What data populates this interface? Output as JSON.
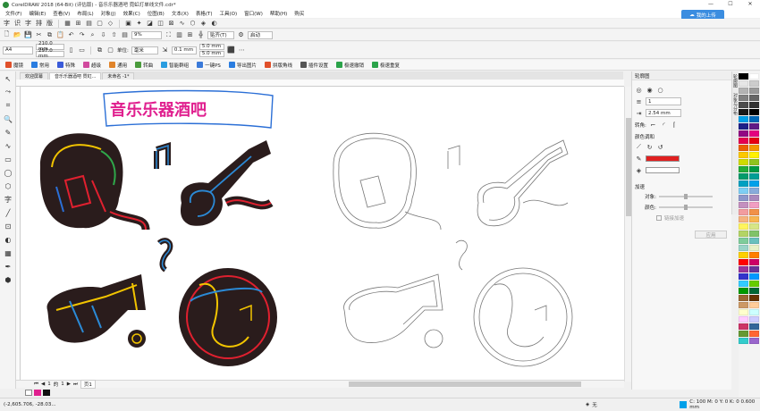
{
  "window": {
    "title": "CorelDRAW 2018 (64-Bit) (评估版) - 音乐乐器酒吧 霓虹灯单线文件.cdr*",
    "controls": [
      "—",
      "☐",
      "✕"
    ]
  },
  "menu": [
    "文件(F)",
    "编辑(E)",
    "查看(V)",
    "布局(L)",
    "对象(J)",
    "效果(C)",
    "位图(B)",
    "文本(X)",
    "表格(T)",
    "工具(O)",
    "窗口(W)",
    "帮助(H)",
    "购买"
  ],
  "cloud_button": "我的上传",
  "standard_bar": {
    "zoom": "9%",
    "snap": "贴齐(T)",
    "launch": "启动"
  },
  "property_bar": {
    "page_size": "A4",
    "width": "210.0 mm",
    "height": "297.0 mm",
    "units": "毫米",
    "nudge": "0.1 mm",
    "dup_x": "5.0 mm",
    "dup_y": "5.0 mm"
  },
  "plugin_bar": [
    "魔镜",
    "常用",
    "特殊",
    "超级",
    "通用",
    "转曲",
    "智能群组",
    "一键PS",
    "导出图片",
    "拼版角线",
    "插件设置",
    "极速撤销",
    "极速重复"
  ],
  "plugin_colors": [
    "#e0502a",
    "#2a7de0",
    "#3b5bd9",
    "#d14a9e",
    "#e0842a",
    "#4a9b3c",
    "#2a9de0",
    "#3b7ad9",
    "#2a7de0",
    "#e0502a",
    "#555555",
    "#2ba34a",
    "#2ba34a"
  ],
  "doc_tabs": [
    "欢迎屏幕",
    "音乐乐器酒吧 霓虹...",
    "未命名 -1*"
  ],
  "toolbox": [
    "↖",
    "⤳",
    "⌗",
    "🔍",
    "✎",
    "∿",
    "▭",
    "◯",
    "⬡",
    "字",
    "╱",
    "⊡",
    "◐",
    "▦",
    "✒",
    "⬢"
  ],
  "canvas": {
    "heading": "音乐乐器酒吧"
  },
  "page_nav": {
    "current": "1",
    "of": "的",
    "total": "1",
    "page_tab": "页1"
  },
  "status": {
    "coords": "(-2,605.706, -28.03...",
    "fill": "无",
    "outline": "C: 100 M: 0 Y: 0 K: 0  0.600 mm"
  },
  "panel": {
    "title": "轮廓图",
    "steps": "1",
    "offset": "2.54 mm",
    "corner_label": "转角:",
    "color_section": "颜色调和",
    "outline_color": "#e02020",
    "fill_color": "#ffffff",
    "accel_section": "加速",
    "object_label": "对象:",
    "color_label": "颜色:",
    "accel_option": "链接加速",
    "apply": "应用"
  },
  "side_tabs": [
    "轮廓图",
    "对象与分布"
  ],
  "palette": [
    "#000000",
    "#ffffff",
    "#e6e6e6",
    "#cccccc",
    "#b3b3b3",
    "#999999",
    "#808080",
    "#666666",
    "#4d4d4d",
    "#333333",
    "#1a1a1a",
    "#000000",
    "#00a0e9",
    "#0068b7",
    "#1d2088",
    "#601986",
    "#920783",
    "#e4007f",
    "#e5004f",
    "#e60012",
    "#eb6100",
    "#f39800",
    "#fcc800",
    "#fff100",
    "#cfdb00",
    "#8fc31f",
    "#22ac38",
    "#009944",
    "#009b6b",
    "#009e96",
    "#00a0c1",
    "#00a0e9",
    "#7ecef4",
    "#88abda",
    "#8c97cb",
    "#aa89bd",
    "#c490bf",
    "#f19ec2",
    "#f29c9f",
    "#f19149",
    "#f6b37f",
    "#f8b551",
    "#fff45c",
    "#d6e586",
    "#b3d465",
    "#80c269",
    "#7ecc9b",
    "#69c0bd",
    "#9ad4c8",
    "#e8f1c6",
    "#fdd000",
    "#ff7f00",
    "#ff0000",
    "#cc0066",
    "#993399",
    "#663399",
    "#3333cc",
    "#0099ff",
    "#33ccff",
    "#66cc00",
    "#009900",
    "#006633",
    "#996633",
    "#663300",
    "#cc9966",
    "#ffcc99",
    "#ffffcc",
    "#ccffff",
    "#ffccff",
    "#ccccff",
    "#cc3366",
    "#336699",
    "#669933",
    "#ff6633",
    "#33cccc",
    "#9966cc"
  ]
}
